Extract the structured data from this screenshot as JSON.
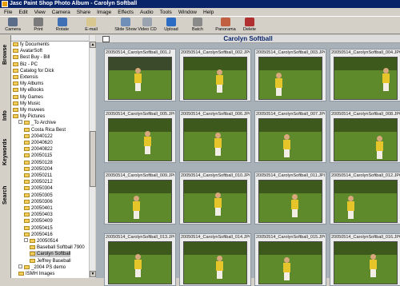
{
  "title": "Jasc Paint Shop Photo Album - Carolyn Softball",
  "menu": [
    "File",
    "Edit",
    "View",
    "Camera",
    "Share",
    "Image",
    "Effects",
    "Audio",
    "Tools",
    "Window",
    "Help"
  ],
  "toolbar": [
    {
      "label": "Camera",
      "icon": "camera-icon",
      "color": "#5a6d8a"
    },
    {
      "label": "Print",
      "icon": "printer-icon",
      "color": "#7a7a7a"
    },
    {
      "label": "Rotate",
      "icon": "rotate-icon",
      "color": "#3f6fb5"
    },
    {
      "label": "E-mail",
      "icon": "email-icon",
      "color": "#d8c890"
    },
    {
      "label": "Slide Show",
      "icon": "slideshow-icon",
      "color": "#6f8fb8"
    },
    {
      "label": "Video CD",
      "icon": "video-cd-icon",
      "color": "#9aa4b0"
    },
    {
      "label": "Upload",
      "icon": "upload-icon",
      "color": "#2c6cc4"
    },
    {
      "label": "Batch",
      "icon": "batch-icon",
      "color": "#8a8a8a"
    },
    {
      "label": "Panorama",
      "icon": "panorama-icon",
      "color": "#c06040"
    },
    {
      "label": "Delete",
      "icon": "delete-icon",
      "color": "#b03030"
    }
  ],
  "side_tabs": [
    "Browse",
    "Info",
    "Keywords",
    "Search"
  ],
  "tree": [
    {
      "label": "fy Documents",
      "indent": 0,
      "folder": true
    },
    {
      "label": "AvatarSoft",
      "indent": 0,
      "folder": true
    },
    {
      "label": "Best Buy - Bill",
      "indent": 0,
      "folder": true
    },
    {
      "label": "Biz - PC",
      "indent": 0,
      "folder": true
    },
    {
      "label": "Catalog for Dick",
      "indent": 0,
      "folder": true
    },
    {
      "label": "Extensis",
      "indent": 0,
      "folder": true
    },
    {
      "label": "My Albums",
      "indent": 0,
      "folder": true
    },
    {
      "label": "My eBooks",
      "indent": 0,
      "folder": true
    },
    {
      "label": "My Games",
      "indent": 0,
      "folder": true
    },
    {
      "label": "My Music",
      "indent": 0,
      "folder": true
    },
    {
      "label": "My muvees",
      "indent": 0,
      "folder": true
    },
    {
      "label": "My Pictures",
      "indent": 0,
      "folder": true
    },
    {
      "label": "_To Archive",
      "indent": 1,
      "folder": true,
      "expander": true
    },
    {
      "label": "Costa Rica Best",
      "indent": 2,
      "folder": true
    },
    {
      "label": "20040122",
      "indent": 2,
      "folder": true
    },
    {
      "label": "20040620",
      "indent": 2,
      "folder": true
    },
    {
      "label": "20040822",
      "indent": 2,
      "folder": true
    },
    {
      "label": "20050115",
      "indent": 2,
      "folder": true
    },
    {
      "label": "20050128",
      "indent": 2,
      "folder": true
    },
    {
      "label": "20050204",
      "indent": 2,
      "folder": true
    },
    {
      "label": "20050211",
      "indent": 2,
      "folder": true
    },
    {
      "label": "20050212",
      "indent": 2,
      "folder": true
    },
    {
      "label": "20050304",
      "indent": 2,
      "folder": true
    },
    {
      "label": "20050305",
      "indent": 2,
      "folder": true
    },
    {
      "label": "20050306",
      "indent": 2,
      "folder": true
    },
    {
      "label": "20050401",
      "indent": 2,
      "folder": true
    },
    {
      "label": "20050403",
      "indent": 2,
      "folder": true
    },
    {
      "label": "20050409",
      "indent": 2,
      "folder": true
    },
    {
      "label": "20050415",
      "indent": 2,
      "folder": true
    },
    {
      "label": "20050416",
      "indent": 2,
      "folder": true
    },
    {
      "label": "20050514",
      "indent": 2,
      "folder": true,
      "expander": true
    },
    {
      "label": "Baseball Softball 7900",
      "indent": 3,
      "folder": true
    },
    {
      "label": "Carolyn Softball",
      "indent": 3,
      "folder": true,
      "selected": true
    },
    {
      "label": "Jeffrey Baseball",
      "indent": 3,
      "folder": true
    },
    {
      "label": "_2004 PS demo",
      "indent": 1,
      "folder": true,
      "expander": true
    },
    {
      "label": "ISMH Images",
      "indent": 1,
      "folder": true
    }
  ],
  "content_title": "Carolyn Softball",
  "thumbnails": [
    "20050514_CarolynSoftball_001.J",
    "20050514_CarolynSoftball_002.JPG",
    "20050514_CarolynSoftball_003.JPG",
    "20050514_CarolynSoftball_004.JPG",
    "20050514_CarolynSoftball_005.JPG",
    "20050514_CarolynSoftball_006.JPG",
    "20050514_CarolynSoftball_007.JPG",
    "20050514_CarolynSoftball_008.JPG",
    "20050514_CarolynSoftball_009.JPG",
    "20050514_CarolynSoftball_010.JPG",
    "20050514_CarolynSoftball_011.JPG",
    "20050514_CarolynSoftball_012.JPG",
    "20050514_CarolynSoftball_013.JPG",
    "20050514_CarolynSoftball_014.JPG",
    "20050514_CarolynSoftball_015.JPG",
    "20050514_CarolynSoftball_016.JPG"
  ]
}
